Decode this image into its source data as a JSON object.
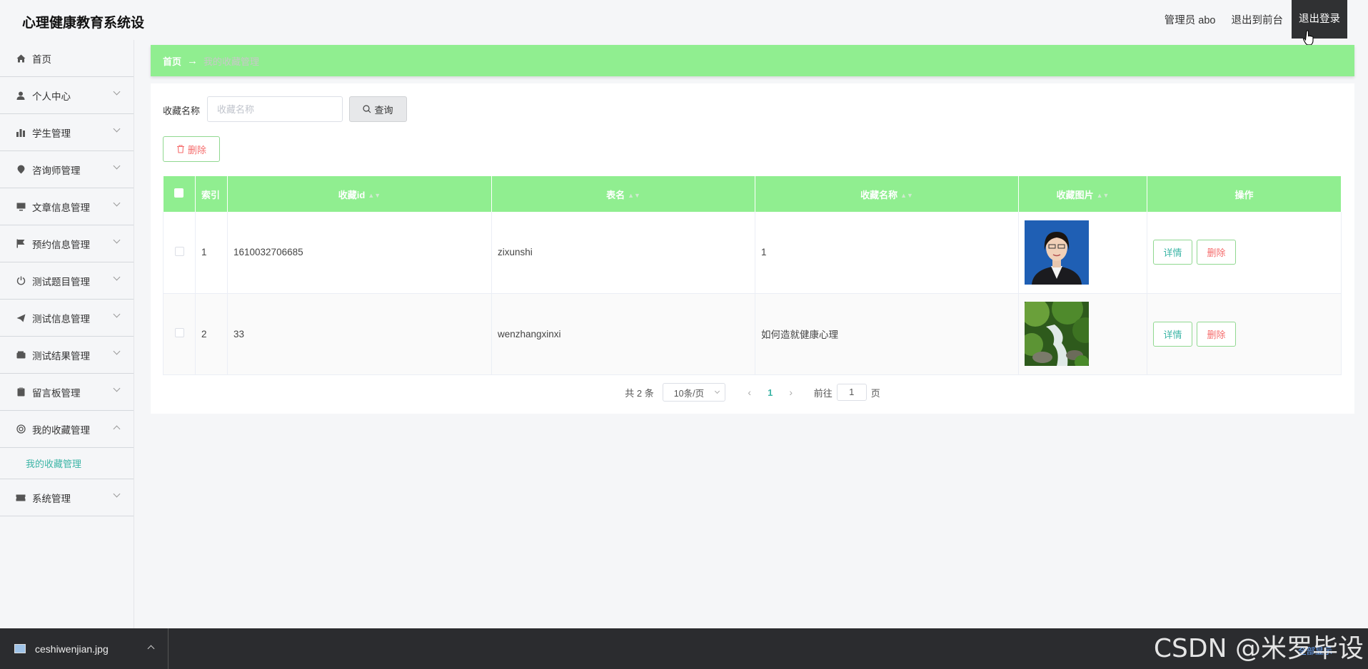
{
  "header": {
    "brand": "心理健康教育系统设",
    "user_label": "管理员 abo",
    "front_link": "退出到前台",
    "logout": "退出登录"
  },
  "sidebar": {
    "items": [
      {
        "label": "首页",
        "icon": "home-icon"
      },
      {
        "label": "个人中心",
        "icon": "user-icon"
      },
      {
        "label": "学生管理",
        "icon": "chart-icon"
      },
      {
        "label": "咨询师管理",
        "icon": "location-icon"
      },
      {
        "label": "文章信息管理",
        "icon": "monitor-icon"
      },
      {
        "label": "预约信息管理",
        "icon": "flag-icon"
      },
      {
        "label": "测试题目管理",
        "icon": "power-icon"
      },
      {
        "label": "测试信息管理",
        "icon": "send-icon"
      },
      {
        "label": "测试结果管理",
        "icon": "wallet-icon"
      },
      {
        "label": "留言板管理",
        "icon": "clipboard-icon"
      },
      {
        "label": "我的收藏管理",
        "icon": "circle-icon"
      },
      {
        "label": "系统管理",
        "icon": "ticket-icon"
      }
    ],
    "active_sub": "我的收藏管理"
  },
  "breadcrumb": {
    "home": "首页",
    "arrow": "→",
    "current": "我的收藏管理"
  },
  "search": {
    "label": "收藏名称",
    "placeholder": "收藏名称",
    "button": "查询"
  },
  "toolbar": {
    "delete": "删除"
  },
  "table": {
    "headers": [
      "索引",
      "收藏id",
      "表名",
      "收藏名称",
      "收藏图片",
      "操作"
    ],
    "rows": [
      {
        "index": "1",
        "id": "1610032706685",
        "table": "zixunshi",
        "name": "1",
        "image": "portrait photo of woman",
        "detail": "详情",
        "delete": "删除"
      },
      {
        "index": "2",
        "id": "33",
        "table": "wenzhangxinxi",
        "name": "如何造就健康心理",
        "image": "forest waterfall photo",
        "detail": "详情",
        "delete": "删除"
      }
    ]
  },
  "pager": {
    "total": "共 2 条",
    "size": "10条/页",
    "prev": "‹",
    "current": "1",
    "next": "›",
    "goto": "前往",
    "jump_value": "1",
    "page_unit": "页"
  },
  "download_bar": {
    "filename": "ceshiwenjian.jpg",
    "show_all": "全部显示"
  },
  "watermark": "CSDN @米罗毕设",
  "colors": {
    "accent_green": "#90ee90",
    "teal_text": "#3cb5a6",
    "danger": "#f56c6c"
  }
}
